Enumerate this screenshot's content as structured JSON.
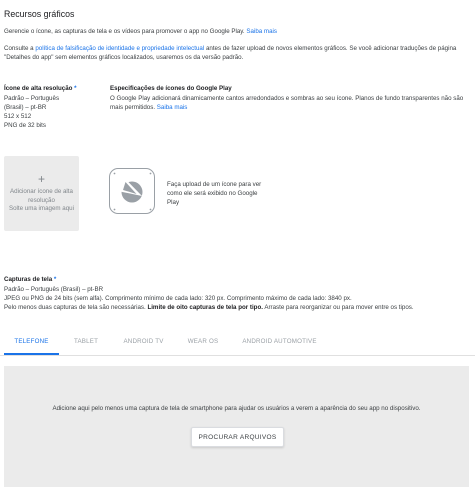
{
  "header": {
    "title": "Recursos gráficos",
    "description": "Gerencie o ícone, as capturas de tela e os vídeos para promover o app no Google Play.",
    "learn_more": "Saiba mais"
  },
  "notice": {
    "prefix": "Consulte a ",
    "link": "política de falsificação de identidade e propriedade intelectual",
    "suffix": " antes de fazer upload de novos elementos gráficos. Se você adicionar traduções de página \"Detalhes do app\" sem elementos gráficos localizados, usaremos os da versão padrão."
  },
  "hi_res_icon": {
    "label": "Ícone de alta resolução",
    "required_marker": "*",
    "language_line1": "Padrão – Português",
    "language_line2": "(Brasil) – pt-BR",
    "dimensions": "512 x 512",
    "format": "PNG de 32 bits",
    "upload_plus": "+",
    "upload_label": "Adicionar ícone de alta resolução",
    "upload_drop": "Solte uma imagem aqui",
    "placeholder_text": "Faça upload de um ícone para ver como ele será exibido no Google Play"
  },
  "icon_specs": {
    "title": "Especificações de ícones do Google Play",
    "text": "O Google Play adicionará dinamicamente cantos arredondados e sombras ao seu ícone. Planos de fundo transparentes não são mais permitidos.",
    "learn_more": "Saiba mais"
  },
  "screenshots": {
    "label": "Capturas de tela",
    "required_marker": "*",
    "language": "Padrão – Português (Brasil) – pt-BR",
    "format": "JPEG ou PNG de 24 bits (sem alfa). Comprimento mínimo de cada lado: 320 px. Comprimento máximo de cada lado: 3840 px.",
    "limits_prefix": "Pelo menos duas capturas de tela são necessárias. ",
    "limits_bold": "Limite de oito capturas de tela por tipo.",
    "limits_suffix": " Arraste para reorganizar ou para mover entre os tipos."
  },
  "tabs": [
    {
      "label": "TELEFONE",
      "active": true
    },
    {
      "label": "TABLET",
      "active": false
    },
    {
      "label": "ANDROID TV",
      "active": false
    },
    {
      "label": "WEAR OS",
      "active": false
    },
    {
      "label": "ANDROID AUTOMOTIVE",
      "active": false
    }
  ],
  "dropzone": {
    "text": "Adicione aqui pelo menos uma captura de tela de smartphone para ajudar os usuários a verem a aparência do seu app no dispositivo.",
    "button": "PROCURAR ARQUIVOS"
  },
  "colors": {
    "accent": "#1a73e8",
    "required": "#1a73e8",
    "dropzone_bg": "#ebebeb"
  }
}
